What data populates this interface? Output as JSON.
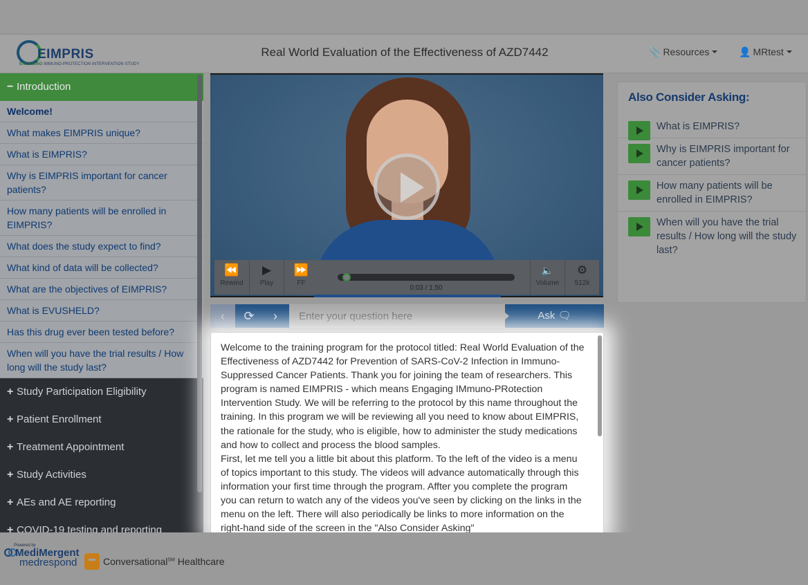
{
  "header": {
    "logo_text": "EIMPRIS",
    "logo_sub_lead": "ENGAGING",
    "logo_sub_rest": "IMMUNO-PROTECTION INTERVENTION STUDY",
    "title": "Real World Evaluation of the Effectiveness of AZD7442",
    "resources_label": "Resources",
    "user_label": "MRtest"
  },
  "sidebar": {
    "active_section": "Introduction",
    "topics": [
      "Welcome!",
      "What makes EIMPRIS unique?",
      "What is EIMPRIS?",
      "Why is EIMPRIS important for cancer patients?",
      "How many patients will be enrolled in EIMPRIS?",
      "What does the study expect to find?",
      "What kind of data will be collected?",
      "What are the objectives of EIMPRIS?",
      "What is EVUSHELD?",
      "Has this drug ever been tested before?",
      "When will you have the trial results / How long will the study last?"
    ],
    "sections": [
      "Study Participation Eligibility",
      "Patient Enrollment",
      "Treatment Appointment",
      "Study Activities",
      "AEs and AE reporting",
      "COVID-19 testing and reporting"
    ]
  },
  "player": {
    "rewind_label": "Rewind",
    "play_label": "Play",
    "ff_label": "FF",
    "volume_label": "Volume",
    "quality_label": "512k",
    "time": "0:03 / 1:50",
    "progress": 0.027
  },
  "ask": {
    "placeholder": "Enter your question here",
    "button_label": "Ask"
  },
  "transcript": {
    "paragraph1": "Welcome to the training program for the protocol titled: Real World Evaluation of the Effectiveness of AZD7442 for Prevention of SARS-CoV-2 Infection in Immuno-Suppressed Cancer Patients. Thank you for joining the team of researchers. This program is named EIMPRIS - which means Engaging IMmuno-PRotection Intervention Study. We will be referring to the protocol by this name throughout the training. In this program we will be reviewing all you need to know about EIMPRIS, the rationale for the study, who is eligible, how to administer the study medications and how to collect and process the blood samples.",
    "paragraph2": "First, let me tell you a little bit about this platform. To the left of the video is a menu of topics important to this study. The videos will advance automatically through this information your first time through the program. Affter you complete the program you can return to watch any of the videos you've seen by clicking on the links in the menu on the left. There will also periodically be links to more information on the right-hand side of the screen in the \"Also Consider Asking\""
  },
  "consider": {
    "title": "Also Consider Asking:",
    "questions": [
      "What is EIMPRIS?",
      "Why is EIMPRIS important for cancer patients?",
      "How many patients will be enrolled in EIMPRIS?",
      "When will you have the trial results / How long will the study last?"
    ]
  },
  "footer": {
    "powered_by": "Powered by",
    "brand_line1": "MediMergent",
    "brand_line2": "medrespond",
    "tagline": "Conversational",
    "tagline_mark": "SM",
    "tagline_end": " Healthcare"
  },
  "colors": {
    "accent_green": "#3f8a3d",
    "nav_blue": "#1e4f82",
    "sidebar_dark": "#2b2e33"
  }
}
